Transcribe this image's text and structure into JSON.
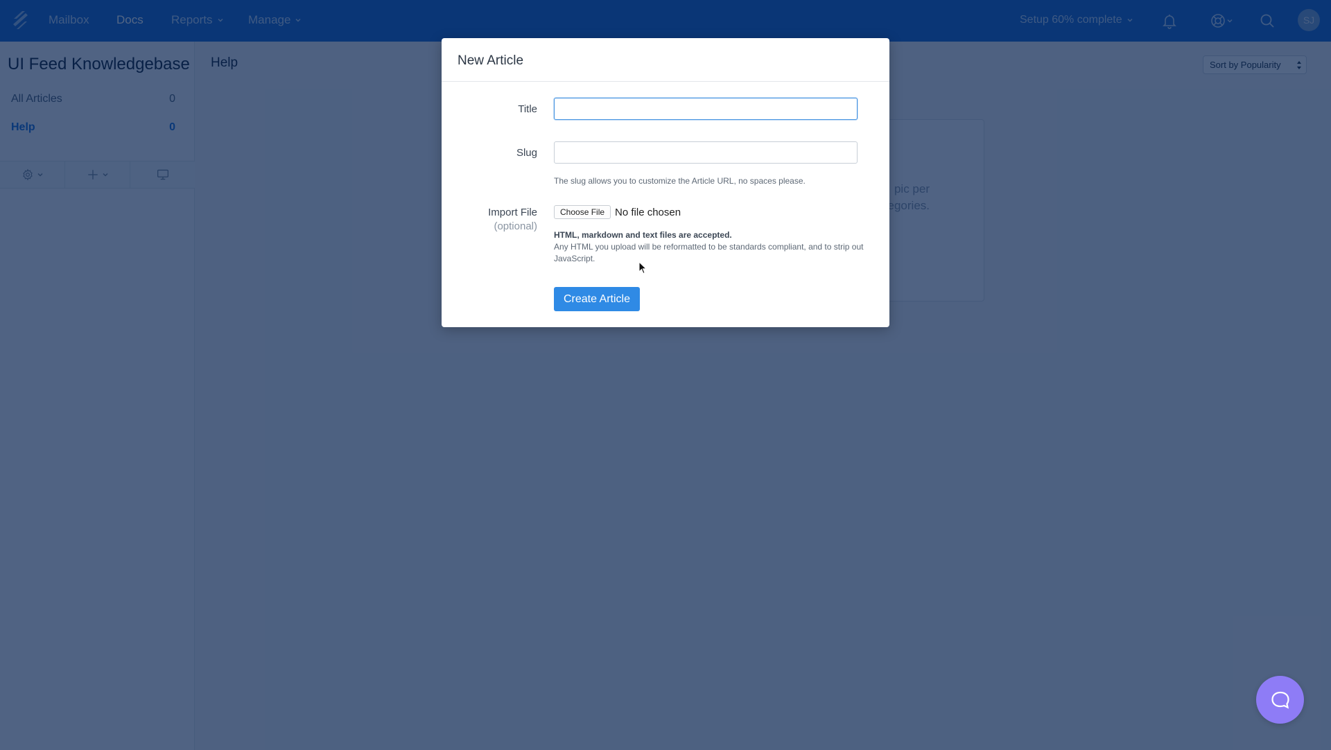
{
  "nav": {
    "items": [
      {
        "label": "Mailbox",
        "active": false,
        "dropdown": false
      },
      {
        "label": "Docs",
        "active": true,
        "dropdown": false
      },
      {
        "label": "Reports",
        "active": false,
        "dropdown": true
      },
      {
        "label": "Manage",
        "active": false,
        "dropdown": true
      }
    ],
    "setup_progress_label": "Setup 60% complete",
    "setup_progress_percent": 60,
    "icons": [
      "bell-icon",
      "lifebuoy-icon",
      "search-icon"
    ],
    "avatar_initials": "SJ"
  },
  "sidebar": {
    "title": "UI Feed Knowledgebase",
    "items": [
      {
        "label": "All Articles",
        "count": "0",
        "active": false
      },
      {
        "label": "Help",
        "count": "0",
        "active": true
      }
    ],
    "tools": [
      "gear-icon",
      "plus-icon",
      "monitor-icon"
    ]
  },
  "main": {
    "title": "Help",
    "sort": {
      "selected": "Sort by Popularity"
    },
    "empty_state": {
      "line1_fragment": "pic per",
      "line2_fragment": "egories."
    }
  },
  "modal": {
    "title": "New Article",
    "fields": {
      "title": {
        "label": "Title",
        "value": "",
        "placeholder": ""
      },
      "slug": {
        "label": "Slug",
        "value": "",
        "placeholder": "",
        "hint": "The slug allows you to customize the Article URL, no spaces please."
      },
      "import_file": {
        "label": "Import File",
        "sublabel": "(optional)",
        "button_label": "Choose File",
        "status": "No file chosen",
        "hint_bold": "HTML, markdown and text files are accepted.",
        "hint": "Any HTML you upload will be reformatted to be standards compliant, and to strip out JavaScript."
      }
    },
    "submit_label": "Create Article"
  },
  "colors": {
    "nav_bg": "#1f6ed4",
    "accent": "#2f8ae5",
    "chat_launcher": "#8e7cf6"
  }
}
